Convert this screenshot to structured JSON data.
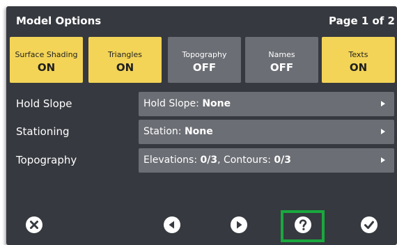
{
  "header": {
    "title": "Model Options",
    "page": "Page 1 of 2"
  },
  "toggles": [
    {
      "label": "Surface Shading",
      "state": "ON"
    },
    {
      "label": "Triangles",
      "state": "ON"
    },
    {
      "label": "Topography",
      "state": "OFF"
    },
    {
      "label": "Names",
      "state": "OFF"
    },
    {
      "label": "Texts",
      "state": "ON"
    }
  ],
  "rows": [
    {
      "label": "Hold Slope",
      "prefix": "Hold Slope: ",
      "value": "None"
    },
    {
      "label": "Stationing",
      "prefix": "Station: ",
      "value": "None"
    },
    {
      "label": "Topography",
      "prefix": "Elevations: ",
      "value": "0/3",
      "sep": ", Contours: ",
      "value2": "0/3"
    }
  ],
  "footer": {
    "icons": [
      "close-icon",
      "previous-icon",
      "next-icon",
      "help-icon",
      "confirm-icon"
    ],
    "highlighted": "help-icon"
  },
  "colors": {
    "background": "#36393f",
    "toggle_on": "#f3d457",
    "toggle_off": "#6b6e74",
    "highlight": "#1aa83e"
  }
}
